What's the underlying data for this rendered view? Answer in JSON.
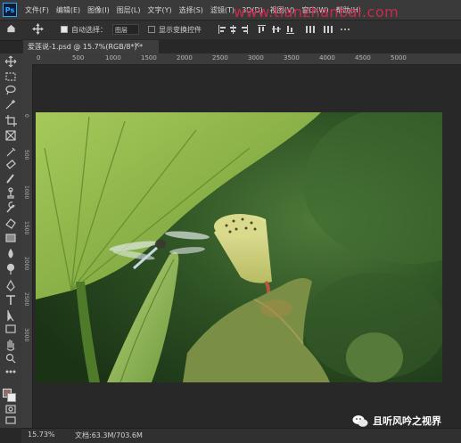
{
  "app": {
    "logo": "Ps"
  },
  "menu": [
    "文件(F)",
    "编辑(E)",
    "图像(I)",
    "图层(L)",
    "文字(Y)",
    "选择(S)",
    "滤镜(T)",
    "3D(D)",
    "视图(V)",
    "窗口(W)",
    "帮助(H)"
  ],
  "watermark": "www.tianzhanbai.com",
  "options": {
    "auto_select_label": "自动选择：",
    "layer_select_value": "图层",
    "show_transform_label": "显示变换控件"
  },
  "document": {
    "tab_title": "爱莲说-1.psd @ 15.7%(RGB/8*) *",
    "close": "×"
  },
  "ruler": {
    "horizontal": [
      "0",
      "500",
      "1000",
      "1500",
      "2000",
      "2500",
      "3000",
      "3500",
      "4000",
      "4500",
      "5000"
    ],
    "vertical": [
      "0",
      "500",
      "1000",
      "1500",
      "2000",
      "2500",
      "3000"
    ]
  },
  "status": {
    "zoom": "15.73%",
    "doc_size": "文档:63.3M/703.6M"
  },
  "wechat": {
    "label": "且听风吟之视界"
  },
  "colors": {
    "foreground": "#8a6f6a",
    "background": "#ececec",
    "accent": "#31a8ff"
  },
  "icons": {
    "toolbar": [
      "move-icon",
      "marquee-icon",
      "lasso-icon",
      "magic-wand-icon",
      "crop-icon",
      "frame-icon",
      "eyedropper-icon",
      "healing-brush-icon",
      "brush-icon",
      "clone-stamp-icon",
      "history-brush-icon",
      "eraser-icon",
      "gradient-icon",
      "blur-icon",
      "dodge-icon",
      "pen-icon",
      "type-icon",
      "path-selection-icon",
      "rectangle-icon",
      "hand-icon",
      "zoom-icon",
      "more-tools-icon"
    ]
  }
}
